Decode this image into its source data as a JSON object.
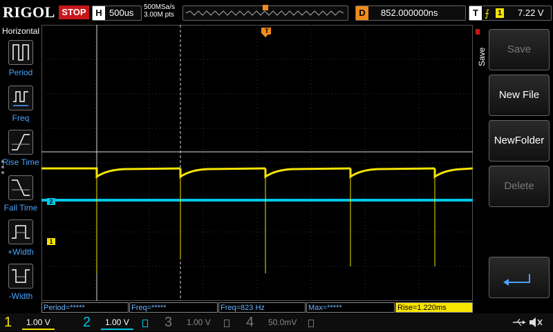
{
  "header": {
    "logo": "RIGOL",
    "run_state": "STOP",
    "horizontal_label": "H",
    "timebase": "500us",
    "sample_rate": "500MSa/s",
    "memory_points": "3.00M pts",
    "delay_label": "D",
    "delay_value": "852.000000ns",
    "trigger_label": "T",
    "trigger_source": "1",
    "trigger_level": "7.22 V"
  },
  "left_menu": {
    "title": "Horizontal",
    "items": [
      {
        "label": "Period",
        "icon": "period-icon"
      },
      {
        "label": "Freq",
        "icon": "freq-icon"
      },
      {
        "label": "Rise Time",
        "icon": "rise-time-icon"
      },
      {
        "label": "Fall Time",
        "icon": "fall-time-icon"
      },
      {
        "label": "+Width",
        "icon": "positive-width-icon"
      },
      {
        "label": "-Width",
        "icon": "negative-width-icon"
      }
    ]
  },
  "right_menu": {
    "title": "Save",
    "buttons": [
      {
        "label": "Save",
        "enabled": false
      },
      {
        "label": "New File",
        "enabled": true
      },
      {
        "label": "NewFolder",
        "enabled": true
      },
      {
        "label": "Delete",
        "enabled": false
      },
      {
        "label": "",
        "icon": "return-arrow-icon",
        "enabled": true
      }
    ]
  },
  "markers": {
    "ch2": "2",
    "ch1": "1",
    "trigger": "T"
  },
  "measurements": [
    {
      "text": "Period=*****"
    },
    {
      "text": "Freq=*****"
    },
    {
      "text": "Freq=823 Hz"
    },
    {
      "text": "Max=*****"
    },
    {
      "text": "Rise=1.220ms",
      "highlight": true
    }
  ],
  "channels": [
    {
      "num": "1",
      "scale": "1.00 V",
      "color": "#f7e400",
      "active": true
    },
    {
      "num": "2",
      "scale": "1.00 V",
      "color": "#00c8e8",
      "active": true
    },
    {
      "num": "3",
      "scale": "1.00 V",
      "color": "#777777",
      "active": false
    },
    {
      "num": "4",
      "scale": "50.0mV",
      "color": "#777777",
      "active": false
    }
  ],
  "status_icons": [
    "usb-icon",
    "speaker-muted-icon"
  ],
  "colors": {
    "ch1": "#f7e400",
    "ch2": "#00c8e8",
    "accent": "#f08a1c",
    "stop": "#c8171b"
  }
}
